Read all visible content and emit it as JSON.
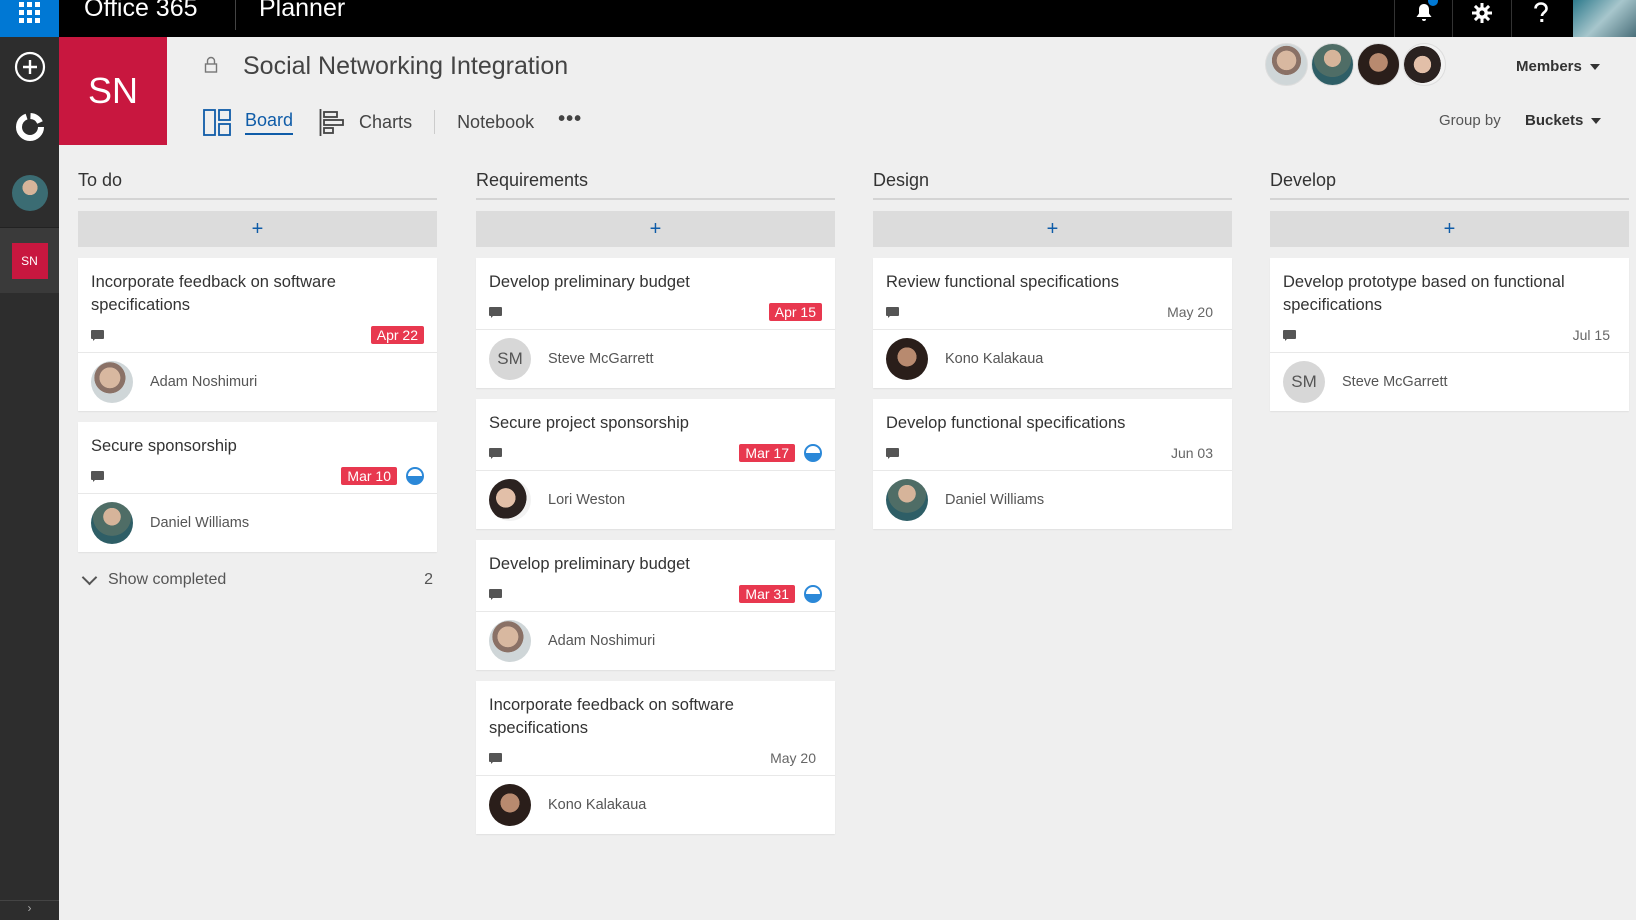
{
  "topbar": {
    "brand": "Office 365",
    "app": "Planner",
    "icons": [
      "waffle-icon",
      "bell-icon",
      "gear-icon",
      "help-icon"
    ]
  },
  "rail": {
    "plan_initials": "SN",
    "icons": [
      "add-icon",
      "hub-icon",
      "user-avatar",
      "plan-tile"
    ]
  },
  "plan": {
    "initials": "SN",
    "title": "Social Networking Integration",
    "accent": "#c8173f",
    "tabs": [
      {
        "label": "Board",
        "active": true
      },
      {
        "label": "Charts",
        "active": false
      },
      {
        "label": "Notebook",
        "active": false
      }
    ],
    "more": "•••",
    "members_label": "Members",
    "group_by_label": "Group by",
    "group_by_value": "Buckets"
  },
  "board": {
    "add_symbol": "+",
    "late_color": "#e8384f",
    "buckets": [
      {
        "name": "To do",
        "cards": [
          {
            "title": "Incorporate feedback on software specifications",
            "due": "Apr 22",
            "late": true,
            "in_progress": false,
            "assignee": "Adam Noshimuri"
          },
          {
            "title": "Secure sponsorship",
            "due": "Mar 10",
            "late": true,
            "in_progress": true,
            "assignee": "Daniel Williams"
          }
        ],
        "show_completed": "Show completed",
        "completed_count": "2"
      },
      {
        "name": "Requirements",
        "cards": [
          {
            "title": "Develop preliminary budget",
            "due": "Apr 15",
            "late": true,
            "in_progress": false,
            "assignee": "Steve McGarrett",
            "initials": "SM"
          },
          {
            "title": "Secure project sponsorship",
            "due": "Mar 17",
            "late": true,
            "in_progress": true,
            "assignee": "Lori Weston"
          },
          {
            "title": "Develop preliminary budget",
            "due": "Mar 31",
            "late": true,
            "in_progress": true,
            "assignee": "Adam Noshimuri"
          },
          {
            "title": "Incorporate feedback on software specifications",
            "due": "May 20",
            "late": false,
            "in_progress": false,
            "assignee": "Kono Kalakaua"
          }
        ]
      },
      {
        "name": "Design",
        "cards": [
          {
            "title": "Review functional specifications",
            "due": "May 20",
            "late": false,
            "in_progress": false,
            "assignee": "Kono Kalakaua"
          },
          {
            "title": "Develop functional specifications",
            "due": "Jun 03",
            "late": false,
            "in_progress": false,
            "assignee": "Daniel Williams"
          }
        ]
      },
      {
        "name": "Develop",
        "cards": [
          {
            "title": "Develop prototype based on functional specifications",
            "due": "Jul 15",
            "late": false,
            "in_progress": false,
            "assignee": "Steve McGarrett",
            "initials": "SM"
          }
        ]
      }
    ]
  }
}
